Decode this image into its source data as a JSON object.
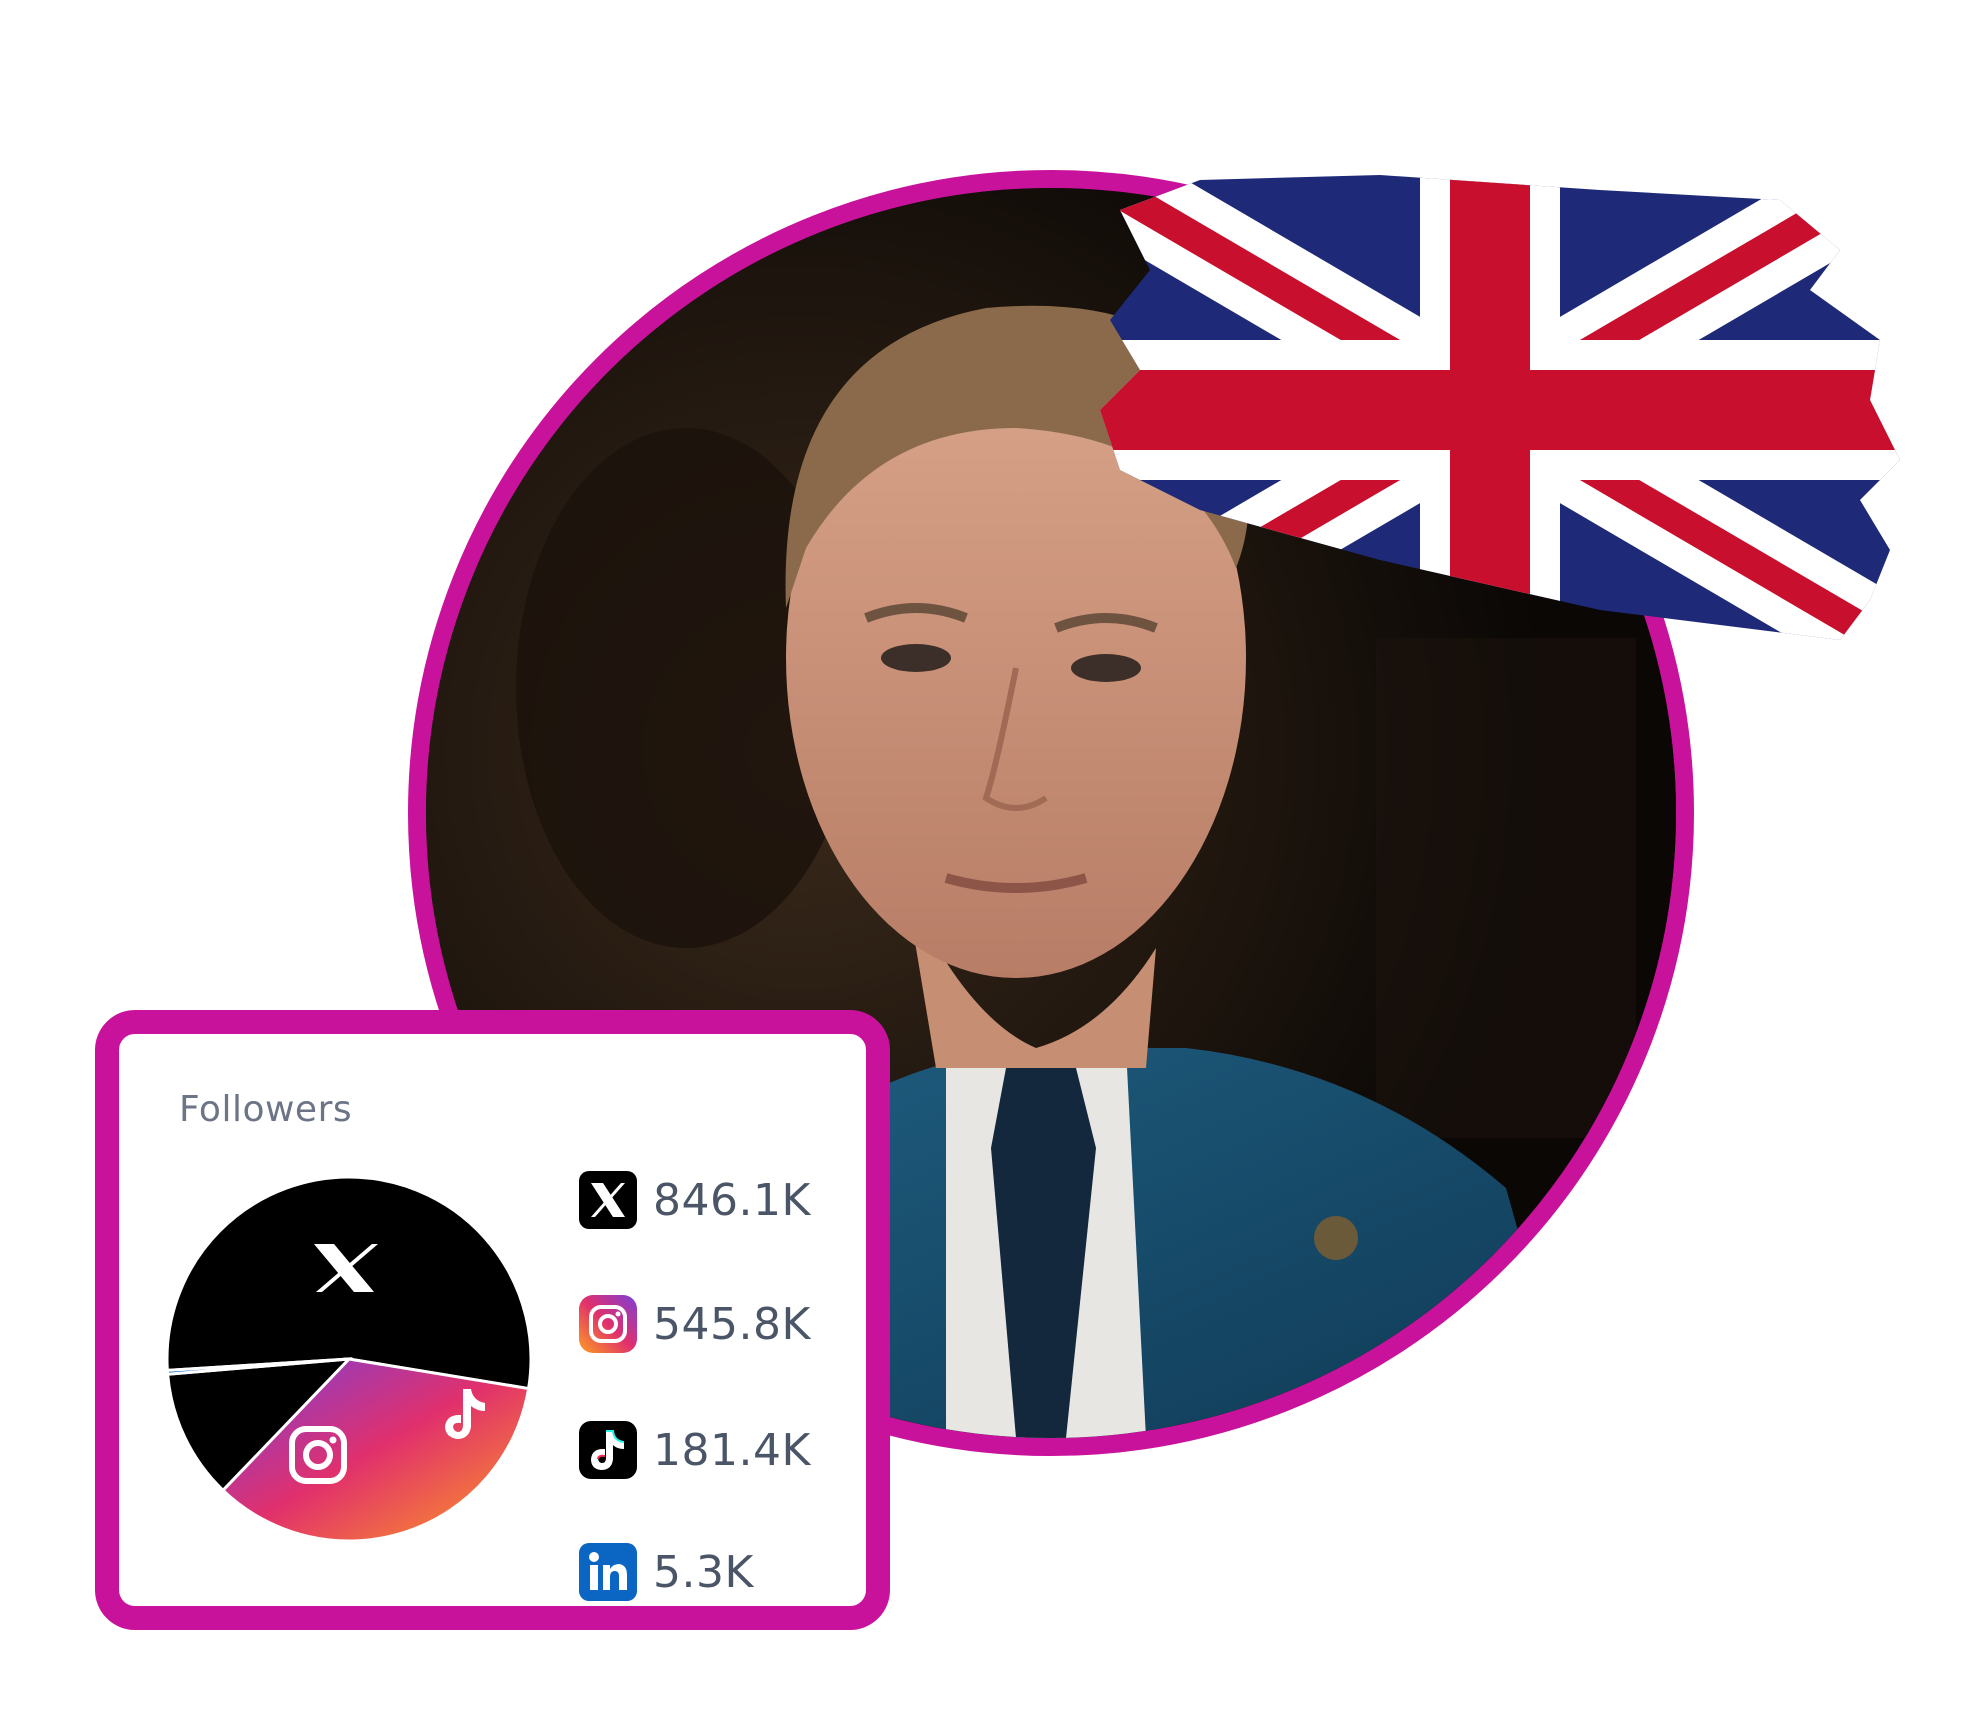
{
  "card": {
    "title": "Followers"
  },
  "chart_data": {
    "type": "pie",
    "slices": [
      {
        "platform": "X",
        "value": 846.1,
        "color": "#000000",
        "icon": "x-logo-icon"
      },
      {
        "platform": "Instagram",
        "value": 545.8,
        "color": "#c13584",
        "icon": "instagram-icon"
      },
      {
        "platform": "TikTok",
        "value": 181.4,
        "color": "#000000",
        "icon": "tiktok-icon"
      },
      {
        "platform": "LinkedIn",
        "value": 5.3,
        "color": "#0a66c2",
        "icon": "linkedin-icon"
      }
    ],
    "units": "K"
  },
  "legend": [
    {
      "icon": "x-logo-icon",
      "value": "846.1K"
    },
    {
      "icon": "instagram-icon",
      "value": "545.8K"
    },
    {
      "icon": "tiktok-icon",
      "value": "181.4K"
    },
    {
      "icon": "linkedin-icon",
      "value": "5.3K"
    }
  ],
  "colors": {
    "accent": "#c8129b",
    "text_muted": "#6b7585",
    "value_text": "#4a5567",
    "flag_blue": "#1e2a78",
    "flag_red": "#c8102e"
  },
  "images": {
    "portrait": "man-in-blue-suit-portrait",
    "flag": "union-jack-flag"
  }
}
